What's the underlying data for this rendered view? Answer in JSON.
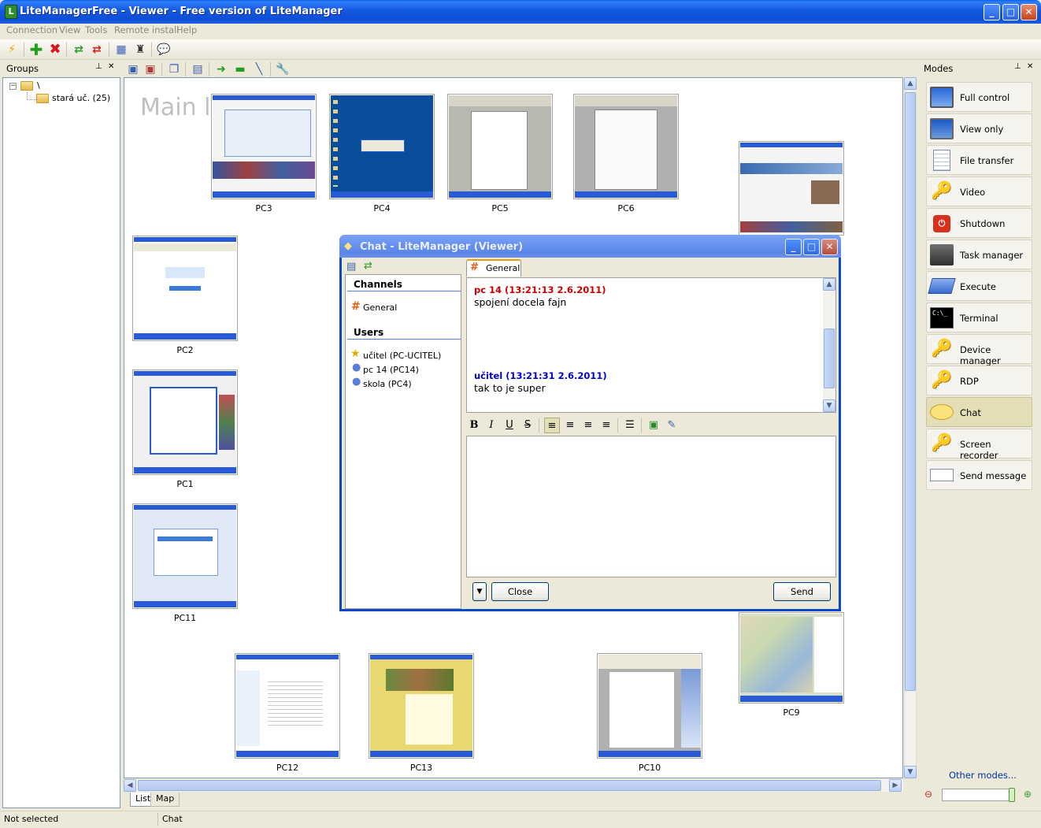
{
  "window": {
    "title": "LiteManagerFree - Viewer - Free version of LiteManager",
    "app_icon": "L",
    "minimize": "_",
    "maximize": "□",
    "close": "✕"
  },
  "menu": [
    "Connection",
    "View",
    "Tools",
    "Remote install",
    "Help"
  ],
  "groups": {
    "header": "Groups",
    "root_label": "\\",
    "child_label": "stará uč. (25)"
  },
  "main": {
    "watermark": "Main la",
    "computers": [
      "PC3",
      "PC4",
      "PC5",
      "PC6",
      "PC2",
      "PC1",
      "PC11",
      "PC12",
      "PC13",
      "PC10",
      "PC9"
    ],
    "tabs": [
      "List",
      "Map"
    ]
  },
  "modes": {
    "header": "Modes",
    "items": [
      {
        "label": "Full control",
        "icon": "monitor-control-icon"
      },
      {
        "label": "View only",
        "icon": "monitor-icon"
      },
      {
        "label": "File transfer",
        "icon": "document-icon"
      },
      {
        "label": "Video",
        "icon": "keys-icon"
      },
      {
        "label": "Shutdown",
        "icon": "power-icon"
      },
      {
        "label": "Task manager",
        "icon": "task-manager-icon"
      },
      {
        "label": "Execute",
        "icon": "execute-icon"
      },
      {
        "label": "Terminal",
        "icon": "terminal-icon"
      },
      {
        "label": "Device manager",
        "icon": "keys-icon"
      },
      {
        "label": "RDP",
        "icon": "keys-icon"
      },
      {
        "label": "Chat",
        "icon": "chat-bubble-icon"
      },
      {
        "label": "Screen recorder",
        "icon": "keys-icon"
      },
      {
        "label": "Send message",
        "icon": "message-icon"
      }
    ],
    "active": "Chat",
    "other_modes": "Other modes..."
  },
  "status": {
    "left": "Not selected",
    "right": "Chat"
  },
  "chat": {
    "title": "Chat - LiteManager (Viewer)",
    "channels_header": "Channels",
    "channel": "General",
    "users_header": "Users",
    "users": [
      "učitel (PC-UCITEL)",
      "pc 14 (PC14)",
      "skola (PC4)"
    ],
    "tab": "General",
    "messages": [
      {
        "header": "pc 14 (13:21:13 2.6.2011)",
        "text": "spojení docela fajn",
        "color": "#cc0000"
      },
      {
        "header": "učitel (13:21:31 2.6.2011)",
        "text": "tak to je super",
        "color": "#0000cc"
      }
    ],
    "format_buttons": [
      "B",
      "I",
      "U",
      "S"
    ],
    "close_label": "Close",
    "send_label": "Send",
    "dropdown_glyph": "▼"
  },
  "colors": {
    "title_blue": "#0f4fd8",
    "chat_active_mode": "#e3deb5"
  }
}
